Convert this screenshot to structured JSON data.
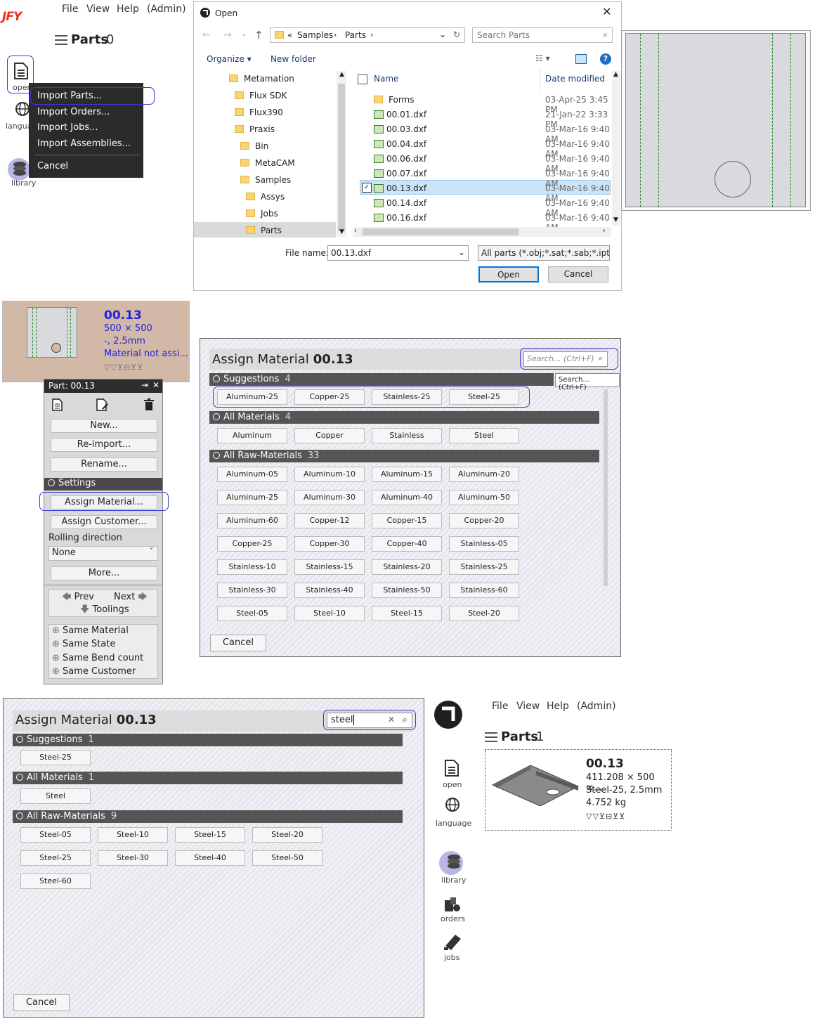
{
  "app": {
    "logo": "JFY",
    "menu": [
      "File",
      "View",
      "Help",
      "(Admin)"
    ],
    "parts_title": "Parts",
    "parts_count": "0",
    "sidebar": {
      "open": "open",
      "language": "language",
      "library": "library"
    }
  },
  "context_menu": {
    "items": [
      "Import Parts...",
      "Import Orders...",
      "Import Jobs...",
      "Import Assemblies..."
    ],
    "cancel": "Cancel"
  },
  "open_dialog": {
    "title": "Open",
    "breadcrumb": {
      "prefix": "«",
      "p1": "Samples",
      "p2": "Parts"
    },
    "search_placeholder": "Search Parts",
    "organize": "Organize",
    "new_folder": "New folder",
    "tree": [
      "Metamation",
      "Flux SDK",
      "Flux390",
      "Praxis",
      "Bin",
      "MetaCAM",
      "Samples",
      "Assys",
      "Jobs",
      "Parts"
    ],
    "columns": {
      "name": "Name",
      "date": "Date modified"
    },
    "files": [
      {
        "name": "Forms",
        "date": "03-Apr-25 3:45 PM",
        "type": "folder"
      },
      {
        "name": "00.01.dxf",
        "date": "21-Jan-22 3:33 PM",
        "type": "dxf"
      },
      {
        "name": "00.03.dxf",
        "date": "03-Mar-16 9:40 AM",
        "type": "dxf"
      },
      {
        "name": "00.04.dxf",
        "date": "03-Mar-16 9:40 AM",
        "type": "dxf"
      },
      {
        "name": "00.06.dxf",
        "date": "03-Mar-16 9:40 AM",
        "type": "dxf"
      },
      {
        "name": "00.07.dxf",
        "date": "03-Mar-16 9:40 AM",
        "type": "dxf"
      },
      {
        "name": "00.13.dxf",
        "date": "03-Mar-16 9:40 AM",
        "type": "dxf",
        "selected": true
      },
      {
        "name": "00.14.dxf",
        "date": "03-Mar-16 9:40 AM",
        "type": "dxf"
      },
      {
        "name": "00.16.dxf",
        "date": "03-Mar-16 9:40 AM",
        "type": "dxf"
      }
    ],
    "file_name_label": "File name:",
    "file_name_value": "00.13.dxf",
    "filter": "All parts (*.obj;*.sat;*.sab;*.ipt;*",
    "open_btn": "Open",
    "cancel_btn": "Cancel"
  },
  "part_card": {
    "name": "00.13",
    "size": "500 × 500",
    "material": "-, 2.5mm",
    "status": "Material not assi..."
  },
  "part_panel": {
    "title": "Part: 00.13",
    "buttons": [
      "New...",
      "Re-import...",
      "Rename..."
    ],
    "settings": "Settings",
    "assign_material": "Assign Material...",
    "assign_customer": "Assign Customer...",
    "rolling_label": "Rolling direction",
    "rolling_value": "None",
    "more": "More...",
    "prev": "Prev",
    "next": "Next",
    "toolings": "Toolings",
    "filters": [
      "Same Material",
      "Same State",
      "Same Bend count",
      "Same Customer"
    ]
  },
  "assign_dialog_1": {
    "title": "Assign Material",
    "part": "00.13",
    "search_placeholder": "Search... (Ctrl+F)",
    "tooltip": "Search... (Ctrl+F)",
    "groups": [
      {
        "name": "Suggestions",
        "count": "4",
        "items": [
          "Aluminum-25",
          "Copper-25",
          "Stainless-25",
          "Steel-25"
        ]
      },
      {
        "name": "All Materials",
        "count": "4",
        "items": [
          "Aluminum",
          "Copper",
          "Stainless",
          "Steel"
        ]
      },
      {
        "name": "All Raw-Materials",
        "count": "33",
        "items": [
          "Aluminum-05",
          "Aluminum-10",
          "Aluminum-15",
          "Aluminum-20",
          "Aluminum-25",
          "Aluminum-30",
          "Aluminum-40",
          "Aluminum-50",
          "Aluminum-60",
          "Copper-12",
          "Copper-15",
          "Copper-20",
          "Copper-25",
          "Copper-30",
          "Copper-40",
          "Stainless-05",
          "Stainless-10",
          "Stainless-15",
          "Stainless-20",
          "Stainless-25",
          "Stainless-30",
          "Stainless-40",
          "Stainless-50",
          "Stainless-60",
          "Steel-05",
          "Steel-10",
          "Steel-15",
          "Steel-20"
        ]
      }
    ],
    "cancel": "Cancel"
  },
  "assign_dialog_2": {
    "title": "Assign Material",
    "part": "00.13",
    "search_value": "steel",
    "groups": [
      {
        "name": "Suggestions",
        "count": "1",
        "items": [
          "Steel-25"
        ]
      },
      {
        "name": "All Materials",
        "count": "1",
        "items": [
          "Steel"
        ]
      },
      {
        "name": "All Raw-Materials",
        "count": "9",
        "items": [
          "Steel-05",
          "Steel-10",
          "Steel-15",
          "Steel-20",
          "Steel-25",
          "Steel-30",
          "Steel-40",
          "Steel-50",
          "Steel-60"
        ]
      }
    ],
    "cancel": "Cancel"
  },
  "app2": {
    "menu": [
      "File",
      "View",
      "Help",
      "(Admin)"
    ],
    "parts_title": "Parts",
    "parts_count": "1",
    "sidebar": [
      "open",
      "language",
      "library",
      "orders",
      "jobs"
    ],
    "card": {
      "name": "00.13",
      "size": "411.208 × 500 ×...",
      "material": "Steel-25, 2.5mm",
      "weight": "4.752 kg"
    }
  },
  "colors": {
    "accent_red": "#e8321e",
    "highlight": "#3a3ad8",
    "card_bg": "#d2b8a6",
    "link_blue": "#2222dd"
  }
}
